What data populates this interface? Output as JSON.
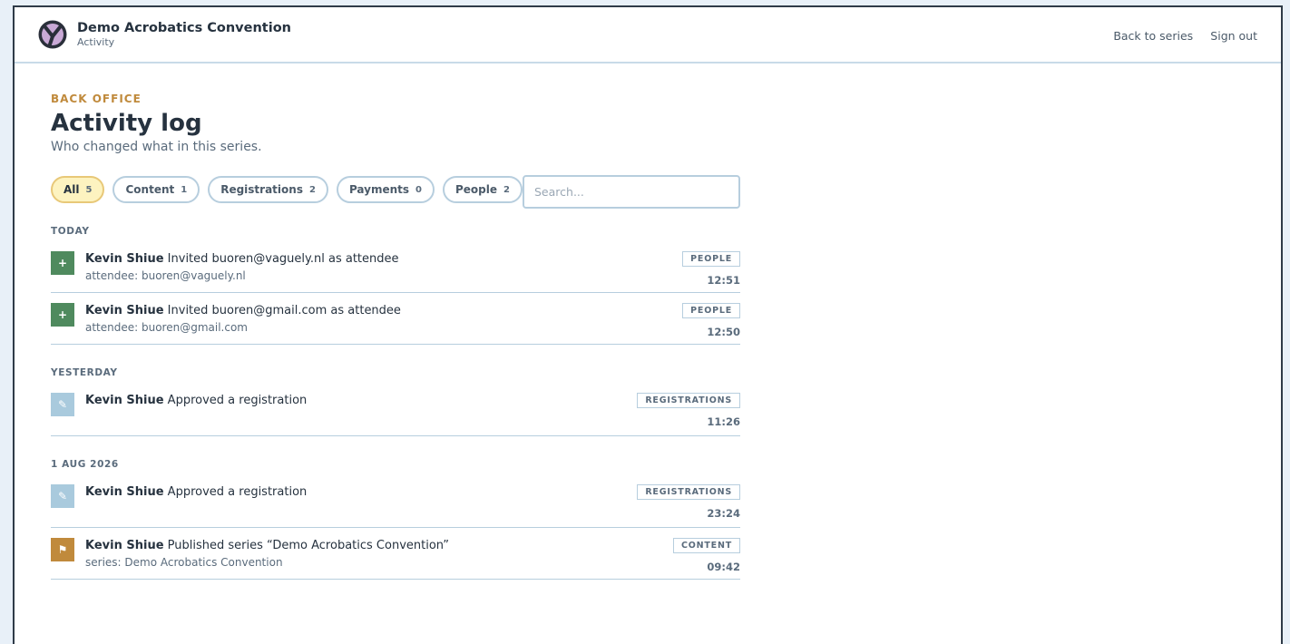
{
  "header": {
    "title": "Demo Acrobatics Convention",
    "subtitle": "Activity",
    "nav": {
      "back": "Back to series",
      "signout": "Sign out"
    }
  },
  "page": {
    "eyebrow": "BACK OFFICE",
    "title": "Activity log",
    "subtitle": "Who changed what in this series."
  },
  "filters": [
    {
      "label": "All",
      "count": "5",
      "active": true
    },
    {
      "label": "Content",
      "count": "1"
    },
    {
      "label": "Registrations",
      "count": "2"
    },
    {
      "label": "Payments",
      "count": "0"
    },
    {
      "label": "People",
      "count": "2"
    }
  ],
  "search": {
    "placeholder": "Search...",
    "value": ""
  },
  "groups": [
    {
      "title": "TODAY",
      "entries": [
        {
          "icon": "plus-icon",
          "actor": "Kevin Shiue",
          "action": "Invited buoren@vaguely.nl as attendee",
          "detail": "attendee: buoren@vaguely.nl",
          "tag": "PEOPLE",
          "time": "12:51"
        },
        {
          "icon": "plus-icon",
          "actor": "Kevin Shiue",
          "action": "Invited buoren@gmail.com as attendee",
          "detail": "attendee: buoren@gmail.com",
          "tag": "PEOPLE",
          "time": "12:50"
        }
      ]
    },
    {
      "title": "YESTERDAY",
      "entries": [
        {
          "icon": "pencil-icon",
          "actor": "Kevin Shiue",
          "action": "Approved a registration",
          "detail": "",
          "tag": "REGISTRATIONS",
          "time": "11:26"
        }
      ]
    },
    {
      "title": "1 AUG 2026",
      "entries": [
        {
          "icon": "pencil-icon",
          "actor": "Kevin Shiue",
          "action": "Approved a registration",
          "detail": "",
          "tag": "REGISTRATIONS",
          "time": "23:24"
        },
        {
          "icon": "flag-icon",
          "actor": "Kevin Shiue",
          "action": "Published series “Demo Acrobatics Convention”",
          "detail": "series: Demo Acrobatics Convention",
          "tag": "CONTENT",
          "time": "09:42"
        }
      ]
    }
  ],
  "colors": {
    "accent": "#c08a3c",
    "people": "#4f8a5e",
    "registrations": "#a9cadd",
    "content": "#c08a3c",
    "active_chip": "#fdf3c0"
  }
}
